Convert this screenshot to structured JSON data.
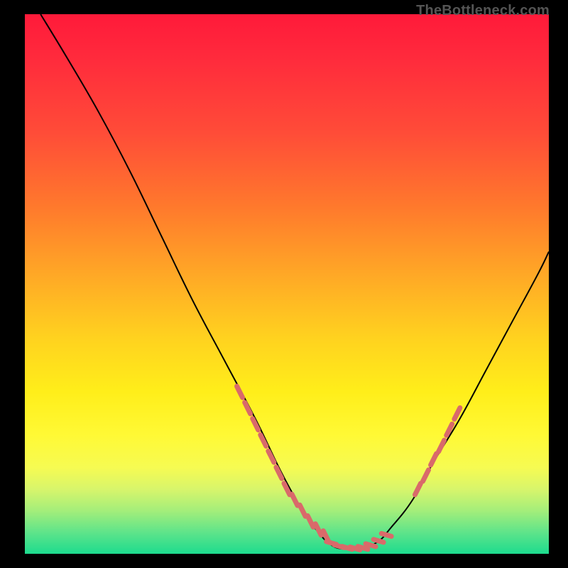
{
  "watermark": "TheBottleneck.com",
  "chart_data": {
    "type": "line",
    "title": "",
    "xlabel": "",
    "ylabel": "",
    "xlim": [
      0,
      100
    ],
    "ylim": [
      0,
      100
    ],
    "series": [
      {
        "name": "curve",
        "color": "#000000",
        "x": [
          3,
          8,
          14,
          20,
          26,
          32,
          38,
          44,
          49,
          53,
          56,
          58,
          60,
          63,
          67,
          70,
          74,
          78,
          83,
          88,
          93,
          98,
          100
        ],
        "y": [
          100,
          92,
          82,
          71,
          59,
          47,
          36,
          25,
          15,
          8,
          4,
          2,
          1,
          1,
          2,
          5,
          10,
          17,
          25,
          34,
          43,
          52,
          56
        ]
      }
    ],
    "marker_clusters": [
      {
        "name": "left-cluster",
        "color": "#d96a6a",
        "style": "dash",
        "points": [
          {
            "x": 41,
            "y": 30
          },
          {
            "x": 42.5,
            "y": 27
          },
          {
            "x": 44,
            "y": 24
          },
          {
            "x": 45.5,
            "y": 21
          },
          {
            "x": 47,
            "y": 18
          },
          {
            "x": 48.5,
            "y": 15
          },
          {
            "x": 50,
            "y": 12
          },
          {
            "x": 51.5,
            "y": 10
          },
          {
            "x": 53,
            "y": 8
          },
          {
            "x": 54.5,
            "y": 6
          },
          {
            "x": 56,
            "y": 4.5
          },
          {
            "x": 57.5,
            "y": 3.2
          }
        ]
      },
      {
        "name": "bottom-cluster",
        "color": "#d96a6a",
        "style": "dash",
        "points": [
          {
            "x": 58.5,
            "y": 2
          },
          {
            "x": 60,
            "y": 1.4
          },
          {
            "x": 61.5,
            "y": 1.1
          },
          {
            "x": 63,
            "y": 1
          },
          {
            "x": 64.5,
            "y": 1.1
          },
          {
            "x": 66,
            "y": 1.6
          },
          {
            "x": 67.5,
            "y": 2.4
          },
          {
            "x": 69,
            "y": 3.5
          }
        ]
      },
      {
        "name": "right-cluster",
        "color": "#d96a6a",
        "style": "dash",
        "points": [
          {
            "x": 75,
            "y": 12
          },
          {
            "x": 76.5,
            "y": 14.5
          },
          {
            "x": 78,
            "y": 17.5
          },
          {
            "x": 79.5,
            "y": 20
          },
          {
            "x": 81,
            "y": 23
          },
          {
            "x": 82.5,
            "y": 26
          }
        ]
      }
    ]
  }
}
